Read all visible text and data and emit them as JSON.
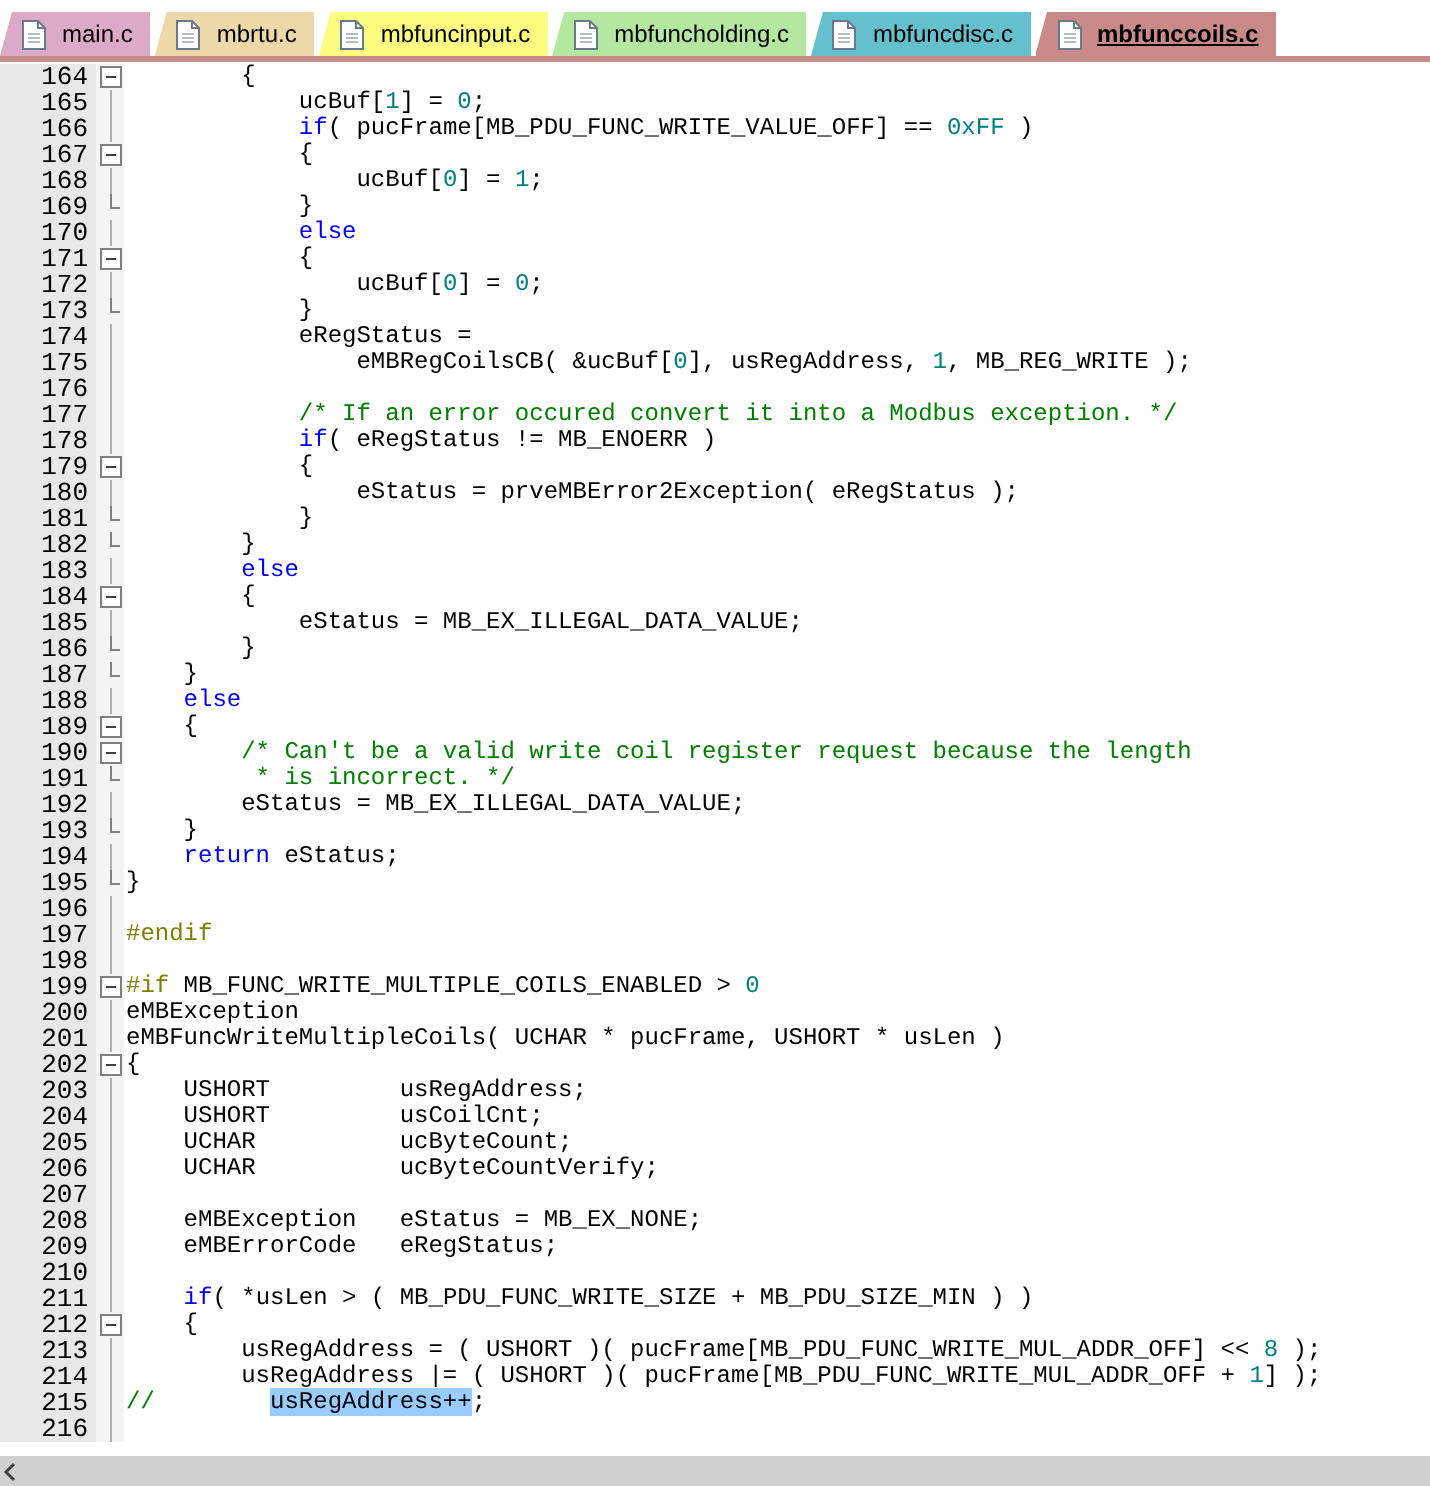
{
  "tabs": [
    {
      "label": "main.c",
      "color": "#dcaac8",
      "selected": false
    },
    {
      "label": "mbrtu.c",
      "color": "#ecd8a8",
      "selected": false
    },
    {
      "label": "mbfuncinput.c",
      "color": "#fcfc80",
      "selected": false
    },
    {
      "label": "mbfuncholding.c",
      "color": "#b4e8a0",
      "selected": false
    },
    {
      "label": "mbfuncdisc.c",
      "color": "#64c0cc",
      "selected": false
    },
    {
      "label": "mbfunccoils.c",
      "color": "#c88a88",
      "selected": true
    }
  ],
  "lines": [
    {
      "number": "164",
      "fold_start": true,
      "fold_end": false,
      "tokens": [
        {
          "kind": "plain",
          "text": "        {"
        }
      ]
    },
    {
      "number": "165",
      "fold_start": false,
      "fold_end": false,
      "tokens": [
        {
          "kind": "plain",
          "text": "            ucBuf["
        },
        {
          "kind": "number",
          "text": "1"
        },
        {
          "kind": "plain",
          "text": "] = "
        },
        {
          "kind": "number",
          "text": "0"
        },
        {
          "kind": "plain",
          "text": ";"
        }
      ]
    },
    {
      "number": "166",
      "fold_start": false,
      "fold_end": false,
      "tokens": [
        {
          "kind": "keyword",
          "text": "            if"
        },
        {
          "kind": "plain",
          "text": "( pucFrame[MB_PDU_FUNC_WRITE_VALUE_OFF] == "
        },
        {
          "kind": "number",
          "text": "0xFF"
        },
        {
          "kind": "plain",
          "text": " )"
        }
      ]
    },
    {
      "number": "167",
      "fold_start": true,
      "fold_end": false,
      "tokens": [
        {
          "kind": "plain",
          "text": "            {"
        }
      ]
    },
    {
      "number": "168",
      "fold_start": false,
      "fold_end": false,
      "tokens": [
        {
          "kind": "plain",
          "text": "                ucBuf["
        },
        {
          "kind": "number",
          "text": "0"
        },
        {
          "kind": "plain",
          "text": "] = "
        },
        {
          "kind": "number",
          "text": "1"
        },
        {
          "kind": "plain",
          "text": ";"
        }
      ]
    },
    {
      "number": "169",
      "fold_start": false,
      "fold_end": true,
      "tokens": [
        {
          "kind": "plain",
          "text": "            }"
        }
      ]
    },
    {
      "number": "170",
      "fold_start": false,
      "fold_end": false,
      "tokens": [
        {
          "kind": "keyword",
          "text": "            else"
        }
      ]
    },
    {
      "number": "171",
      "fold_start": true,
      "fold_end": false,
      "tokens": [
        {
          "kind": "plain",
          "text": "            {"
        }
      ]
    },
    {
      "number": "172",
      "fold_start": false,
      "fold_end": false,
      "tokens": [
        {
          "kind": "plain",
          "text": "                ucBuf["
        },
        {
          "kind": "number",
          "text": "0"
        },
        {
          "kind": "plain",
          "text": "] = "
        },
        {
          "kind": "number",
          "text": "0"
        },
        {
          "kind": "plain",
          "text": ";"
        }
      ]
    },
    {
      "number": "173",
      "fold_start": false,
      "fold_end": true,
      "tokens": [
        {
          "kind": "plain",
          "text": "            }"
        }
      ]
    },
    {
      "number": "174",
      "fold_start": false,
      "fold_end": false,
      "tokens": [
        {
          "kind": "plain",
          "text": "            eRegStatus ="
        }
      ]
    },
    {
      "number": "175",
      "fold_start": false,
      "fold_end": false,
      "tokens": [
        {
          "kind": "plain",
          "text": "                eMBRegCoilsCB( &ucBuf["
        },
        {
          "kind": "number",
          "text": "0"
        },
        {
          "kind": "plain",
          "text": "], usRegAddress, "
        },
        {
          "kind": "number",
          "text": "1"
        },
        {
          "kind": "plain",
          "text": ", MB_REG_WRITE );"
        }
      ]
    },
    {
      "number": "176",
      "fold_start": false,
      "fold_end": false
    },
    {
      "number": "177",
      "fold_start": false,
      "fold_end": false,
      "tokens": [
        {
          "kind": "comment",
          "text": "            /* If an error occured convert it into a Modbus exception. */"
        }
      ]
    },
    {
      "number": "178",
      "fold_start": false,
      "fold_end": false,
      "tokens": [
        {
          "kind": "keyword",
          "text": "            if"
        },
        {
          "kind": "plain",
          "text": "( eRegStatus != MB_ENOERR )"
        }
      ]
    },
    {
      "number": "179",
      "fold_start": true,
      "fold_end": false,
      "tokens": [
        {
          "kind": "plain",
          "text": "            {"
        }
      ]
    },
    {
      "number": "180",
      "fold_start": false,
      "fold_end": false,
      "tokens": [
        {
          "kind": "plain",
          "text": "                eStatus = prveMBError2Exception( eRegStatus );"
        }
      ]
    },
    {
      "number": "181",
      "fold_start": false,
      "fold_end": true,
      "tokens": [
        {
          "kind": "plain",
          "text": "            }"
        }
      ]
    },
    {
      "number": "182",
      "fold_start": false,
      "fold_end": true,
      "tokens": [
        {
          "kind": "plain",
          "text": "        }"
        }
      ]
    },
    {
      "number": "183",
      "fold_start": false,
      "fold_end": false,
      "tokens": [
        {
          "kind": "keyword",
          "text": "        else"
        }
      ]
    },
    {
      "number": "184",
      "fold_start": true,
      "fold_end": false,
      "tokens": [
        {
          "kind": "plain",
          "text": "        {"
        }
      ]
    },
    {
      "number": "185",
      "fold_start": false,
      "fold_end": false,
      "tokens": [
        {
          "kind": "plain",
          "text": "            eStatus = MB_EX_ILLEGAL_DATA_VALUE;"
        }
      ]
    },
    {
      "number": "186",
      "fold_start": false,
      "fold_end": true,
      "tokens": [
        {
          "kind": "plain",
          "text": "        }"
        }
      ]
    },
    {
      "number": "187",
      "fold_start": false,
      "fold_end": true,
      "tokens": [
        {
          "kind": "plain",
          "text": "    }"
        }
      ]
    },
    {
      "number": "188",
      "fold_start": false,
      "fold_end": false,
      "tokens": [
        {
          "kind": "keyword",
          "text": "    else"
        }
      ]
    },
    {
      "number": "189",
      "fold_start": true,
      "fold_end": false,
      "tokens": [
        {
          "kind": "plain",
          "text": "    {"
        }
      ]
    },
    {
      "number": "190",
      "fold_start": true,
      "fold_end": false,
      "tokens": [
        {
          "kind": "comment",
          "text": "        /* Can't be a valid write coil register request because the length"
        }
      ]
    },
    {
      "number": "191",
      "fold_start": false,
      "fold_end": true,
      "tokens": [
        {
          "kind": "comment",
          "text": "         * is incorrect. */"
        }
      ]
    },
    {
      "number": "192",
      "fold_start": false,
      "fold_end": false,
      "tokens": [
        {
          "kind": "plain",
          "text": "        eStatus = MB_EX_ILLEGAL_DATA_VALUE;"
        }
      ]
    },
    {
      "number": "193",
      "fold_start": false,
      "fold_end": true,
      "tokens": [
        {
          "kind": "plain",
          "text": "    }"
        }
      ]
    },
    {
      "number": "194",
      "fold_start": false,
      "fold_end": false,
      "tokens": [
        {
          "kind": "keyword",
          "text": "    return"
        },
        {
          "kind": "plain",
          "text": " eStatus;"
        }
      ]
    },
    {
      "number": "195",
      "fold_start": false,
      "fold_end": true,
      "tokens": [
        {
          "kind": "plain",
          "text": "}"
        }
      ]
    },
    {
      "number": "196",
      "fold_start": false,
      "fold_end": false
    },
    {
      "number": "197",
      "fold_start": false,
      "fold_end": false,
      "tokens": [
        {
          "kind": "preprocessor",
          "text": "#endif"
        }
      ]
    },
    {
      "number": "198",
      "fold_start": false,
      "fold_end": false
    },
    {
      "number": "199",
      "fold_start": true,
      "fold_end": false,
      "tokens": [
        {
          "kind": "preprocessor",
          "text": "#if"
        },
        {
          "kind": "plain",
          "text": " MB_FUNC_WRITE_MULTIPLE_COILS_ENABLED > "
        },
        {
          "kind": "number",
          "text": "0"
        }
      ]
    },
    {
      "number": "200",
      "fold_start": false,
      "fold_end": false,
      "tokens": [
        {
          "kind": "plain",
          "text": "eMBException"
        }
      ]
    },
    {
      "number": "201",
      "fold_start": false,
      "fold_end": false,
      "tokens": [
        {
          "kind": "plain",
          "text": "eMBFuncWriteMultipleCoils( UCHAR * pucFrame, USHORT * usLen )"
        }
      ]
    },
    {
      "number": "202",
      "fold_start": true,
      "fold_end": false,
      "tokens": [
        {
          "kind": "plain",
          "text": "{"
        }
      ]
    },
    {
      "number": "203",
      "fold_start": false,
      "fold_end": false,
      "tokens": [
        {
          "kind": "plain",
          "text": "    USHORT         usRegAddress;"
        }
      ]
    },
    {
      "number": "204",
      "fold_start": false,
      "fold_end": false,
      "tokens": [
        {
          "kind": "plain",
          "text": "    USHORT         usCoilCnt;"
        }
      ]
    },
    {
      "number": "205",
      "fold_start": false,
      "fold_end": false,
      "tokens": [
        {
          "kind": "plain",
          "text": "    UCHAR          ucByteCount;"
        }
      ]
    },
    {
      "number": "206",
      "fold_start": false,
      "fold_end": false,
      "tokens": [
        {
          "kind": "plain",
          "text": "    UCHAR          ucByteCountVerify;"
        }
      ]
    },
    {
      "number": "207",
      "fold_start": false,
      "fold_end": false
    },
    {
      "number": "208",
      "fold_start": false,
      "fold_end": false,
      "tokens": [
        {
          "kind": "plain",
          "text": "    eMBException   eStatus = MB_EX_NONE;"
        }
      ]
    },
    {
      "number": "209",
      "fold_start": false,
      "fold_end": false,
      "tokens": [
        {
          "kind": "plain",
          "text": "    eMBErrorCode   eRegStatus;"
        }
      ]
    },
    {
      "number": "210",
      "fold_start": false,
      "fold_end": false
    },
    {
      "number": "211",
      "fold_start": false,
      "fold_end": false,
      "tokens": [
        {
          "kind": "keyword",
          "text": "    if"
        },
        {
          "kind": "plain",
          "text": "( *usLen > ( MB_PDU_FUNC_WRITE_SIZE + MB_PDU_SIZE_MIN ) )"
        }
      ]
    },
    {
      "number": "212",
      "fold_start": true,
      "fold_end": false,
      "tokens": [
        {
          "kind": "plain",
          "text": "    {"
        }
      ]
    },
    {
      "number": "213",
      "fold_start": false,
      "fold_end": false,
      "tokens": [
        {
          "kind": "plain",
          "text": "        usRegAddress = ( USHORT )( pucFrame[MB_PDU_FUNC_WRITE_MUL_ADDR_OFF] << "
        },
        {
          "kind": "number",
          "text": "8"
        },
        {
          "kind": "plain",
          "text": " );"
        }
      ]
    },
    {
      "number": "214",
      "fold_start": false,
      "fold_end": false,
      "tokens": [
        {
          "kind": "plain",
          "text": "        usRegAddress |= ( USHORT )( pucFrame[MB_PDU_FUNC_WRITE_MUL_ADDR_OFF + "
        },
        {
          "kind": "number",
          "text": "1"
        },
        {
          "kind": "plain",
          "text": "] );"
        }
      ]
    },
    {
      "number": "215",
      "fold_start": false,
      "fold_end": false,
      "tokens": [
        {
          "kind": "comment",
          "text": "//        "
        },
        {
          "kind": "selected",
          "text": "usRegAddress++"
        },
        {
          "kind": "plain",
          "text": ";"
        }
      ]
    },
    {
      "number": "216",
      "fold_start": false,
      "fold_end": false
    }
  ]
}
